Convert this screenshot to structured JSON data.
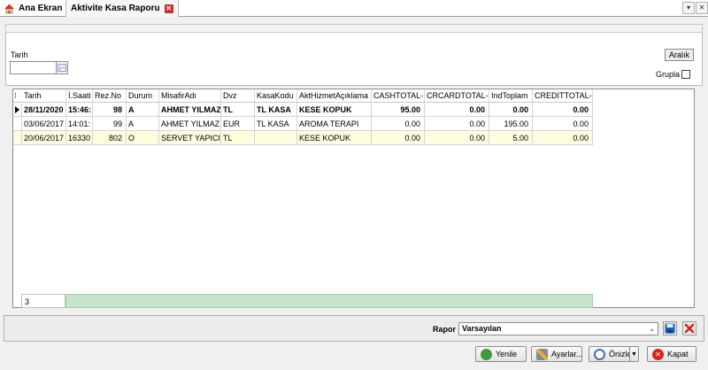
{
  "tabs": [
    {
      "label": "Ana Ekran"
    },
    {
      "label": "Aktivite Kasa Raporu"
    }
  ],
  "filter": {
    "date_label": "Tarih",
    "date_value": "",
    "range_button": "Aralık",
    "group_label": "Grupla",
    "group_checked": false
  },
  "grid": {
    "columns": [
      "Tarih",
      "İ.Saati",
      "Rez.No",
      "Durum",
      "MisafirAdı",
      "Dvz",
      "KasaKodu",
      "AktHizmetAçıklama",
      "CASHTOTAL-",
      "CRCARDTOTAL-",
      "IndToplam",
      "CREDITTOTAL-"
    ],
    "rows": [
      [
        "28/11/2020",
        "15:46:",
        "98",
        "A",
        "AHMET YILMAZ",
        "TL",
        "TL KASA",
        "KESE KOPUK",
        "95.00",
        "0.00",
        "0.00",
        "0.00"
      ],
      [
        "03/06/2017",
        "14:01:",
        "99",
        "A",
        "AHMET YILMAZ",
        "EUR",
        "TL KASA",
        "AROMA TERAPI",
        "0.00",
        "0.00",
        "195.00",
        "0.00"
      ],
      [
        "20/06/2017",
        "16330",
        "802",
        "O",
        "SERVET YAPICI",
        "TL",
        "",
        "KESE KOPUK",
        "0.00",
        "0.00",
        "5.00",
        "0.00"
      ]
    ],
    "footer_count": "3"
  },
  "report": {
    "label": "Rapor",
    "selected": "Varsayılan"
  },
  "buttons": {
    "refresh": "Yenile",
    "settings": "Ayarlar...",
    "preview": "Önizle",
    "close": "Kapat"
  }
}
